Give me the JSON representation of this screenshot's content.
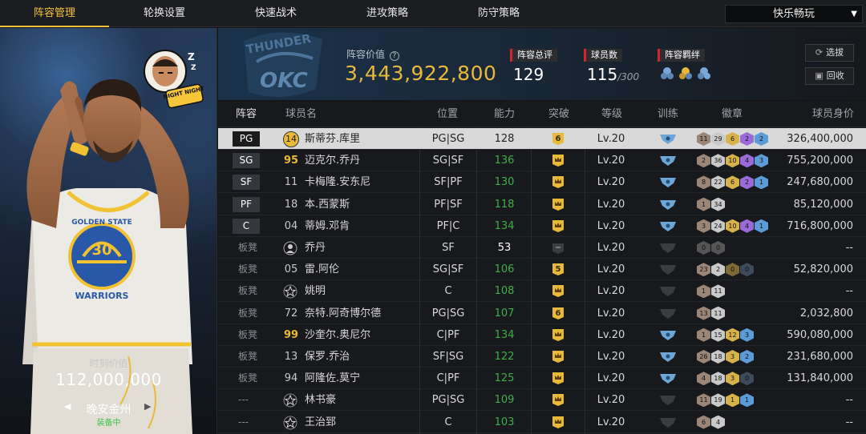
{
  "tabs": [
    {
      "label": "阵容管理",
      "active": true
    },
    {
      "label": "轮换设置",
      "active": false
    },
    {
      "label": "快速战术",
      "active": false
    },
    {
      "label": "进攻策略",
      "active": false
    },
    {
      "label": "防守策略",
      "active": false
    }
  ],
  "mode_dropdown": {
    "value": "快乐畅玩"
  },
  "player_card": {
    "emote_text": "NIGHT NIGHT",
    "moment_label": "时刻价值",
    "moment_value": "112,000,000",
    "card_name": "晚安金州",
    "status": "装备中"
  },
  "header": {
    "team_logo_text": "OKC",
    "lineup_value_label": "阵容价值",
    "lineup_value": "3,443,922,800",
    "overall_label": "阵容总评",
    "overall_value": "129",
    "player_count_label": "球员数",
    "player_count": "115",
    "player_capacity": "/300",
    "bonds_label": "阵容羁绊",
    "select_button": "选拔",
    "recycle_button": "回收"
  },
  "table": {
    "columns": [
      "阵容",
      "球员名",
      "位置",
      "能力",
      "突破",
      "等级",
      "训练",
      "徽章",
      "球员身价"
    ],
    "rows": [
      {
        "slot": "PG",
        "jersey": "14",
        "jersey_style": "circle",
        "name": "斯蒂芬.库里",
        "position": "PG|SG",
        "ability": "128",
        "breakthrough": "6",
        "level": "Lv.20",
        "training": "active",
        "badges": [
          {
            "n": "11",
            "c": "#9b8576"
          },
          {
            "n": "29",
            "c": "#c9c9c9"
          },
          {
            "n": "6",
            "c": "#d6b24a"
          },
          {
            "n": "2",
            "c": "#9a6bd8"
          },
          {
            "n": "2",
            "c": "#5b9bd8"
          }
        ],
        "value": "326,400,000",
        "selected": true
      },
      {
        "slot": "SG",
        "jersey": "95",
        "jersey_style": "gold",
        "name": "迈克尔.乔丹",
        "position": "SG|SF",
        "ability": "136",
        "breakthrough": "crown",
        "level": "Lv.20",
        "training": "active",
        "badges": [
          {
            "n": "2",
            "c": "#9b8576"
          },
          {
            "n": "36",
            "c": "#c9c9c9"
          },
          {
            "n": "10",
            "c": "#d6b24a"
          },
          {
            "n": "4",
            "c": "#9a6bd8"
          },
          {
            "n": "3",
            "c": "#5b9bd8"
          }
        ],
        "value": "755,200,000"
      },
      {
        "slot": "SF",
        "jersey": "11",
        "jersey_style": "plain",
        "name": "卡梅隆.安东尼",
        "position": "SF|PF",
        "ability": "130",
        "breakthrough": "crown",
        "level": "Lv.20",
        "training": "active",
        "badges": [
          {
            "n": "8",
            "c": "#9b8576"
          },
          {
            "n": "22",
            "c": "#c9c9c9"
          },
          {
            "n": "6",
            "c": "#d6b24a"
          },
          {
            "n": "2",
            "c": "#9a6bd8"
          },
          {
            "n": "1",
            "c": "#5b9bd8"
          }
        ],
        "value": "247,680,000"
      },
      {
        "slot": "PF",
        "jersey": "18",
        "jersey_style": "plain",
        "name": "本.西蒙斯",
        "position": "PF|SF",
        "ability": "118",
        "breakthrough": "crown",
        "level": "Lv.20",
        "training": "active",
        "badges": [
          {
            "n": "1",
            "c": "#9b8576"
          },
          {
            "n": "34",
            "c": "#c9c9c9"
          }
        ],
        "value": "85,120,000"
      },
      {
        "slot": "C",
        "jersey": "04",
        "jersey_style": "plain",
        "name": "蒂姆.邓肯",
        "position": "PF|C",
        "ability": "134",
        "breakthrough": "crown",
        "level": "Lv.20",
        "training": "active",
        "badges": [
          {
            "n": "3",
            "c": "#9b8576"
          },
          {
            "n": "24",
            "c": "#c9c9c9"
          },
          {
            "n": "10",
            "c": "#d6b24a"
          },
          {
            "n": "4",
            "c": "#9a6bd8"
          },
          {
            "n": "1",
            "c": "#5b9bd8"
          }
        ],
        "value": "716,800,000"
      },
      {
        "slot": "板凳",
        "jersey": "",
        "jersey_style": "anon",
        "name": "乔丹",
        "position": "SF",
        "ability": "53",
        "breakthrough": "none",
        "level": "Lv.20",
        "training": "inactive",
        "badges": [
          {
            "n": "0",
            "c": "#555"
          },
          {
            "n": "0",
            "c": "#555"
          }
        ],
        "value": "--"
      },
      {
        "slot": "板凳",
        "jersey": "05",
        "jersey_style": "plain",
        "name": "雷.阿伦",
        "position": "SG|SF",
        "ability": "106",
        "breakthrough": "5",
        "level": "Lv.20",
        "training": "inactive",
        "badges": [
          {
            "n": "23",
            "c": "#9b8576"
          },
          {
            "n": "2",
            "c": "#c9c9c9"
          },
          {
            "n": "0",
            "c": "#7d6a36"
          },
          {
            "n": "0",
            "c": "#3d4a5a"
          }
        ],
        "value": "52,820,000"
      },
      {
        "slot": "板凳",
        "jersey": "",
        "jersey_style": "star",
        "name": "姚明",
        "position": "C",
        "ability": "108",
        "breakthrough": "crown",
        "level": "Lv.20",
        "training": "inactive",
        "badges": [
          {
            "n": "1",
            "c": "#9b8576"
          },
          {
            "n": "11",
            "c": "#c9c9c9"
          }
        ],
        "value": "--"
      },
      {
        "slot": "板凳",
        "jersey": "72",
        "jersey_style": "plain",
        "name": "奈特.阿奇博尔德",
        "position": "PG|SG",
        "ability": "107",
        "breakthrough": "6",
        "level": "Lv.20",
        "training": "inactive",
        "badges": [
          {
            "n": "13",
            "c": "#9b8576"
          },
          {
            "n": "11",
            "c": "#c9c9c9"
          }
        ],
        "value": "2,032,800"
      },
      {
        "slot": "板凳",
        "jersey": "99",
        "jersey_style": "gold",
        "name": "沙奎尔.奥尼尔",
        "position": "C|PF",
        "ability": "134",
        "breakthrough": "crown",
        "level": "Lv.20",
        "training": "active",
        "badges": [
          {
            "n": "1",
            "c": "#9b8576"
          },
          {
            "n": "15",
            "c": "#c9c9c9"
          },
          {
            "n": "12",
            "c": "#d6b24a"
          },
          {
            "n": "3",
            "c": "#5b9bd8"
          }
        ],
        "value": "590,080,000"
      },
      {
        "slot": "板凳",
        "jersey": "13",
        "jersey_style": "plain",
        "name": "保罗.乔治",
        "position": "SF|SG",
        "ability": "122",
        "breakthrough": "crown",
        "level": "Lv.20",
        "training": "active",
        "badges": [
          {
            "n": "26",
            "c": "#9b8576"
          },
          {
            "n": "18",
            "c": "#c9c9c9"
          },
          {
            "n": "3",
            "c": "#d6b24a"
          },
          {
            "n": "2",
            "c": "#5b9bd8"
          }
        ],
        "value": "231,680,000"
      },
      {
        "slot": "板凳",
        "jersey": "94",
        "jersey_style": "plain",
        "name": "阿隆佐.莫宁",
        "position": "C|PF",
        "ability": "125",
        "breakthrough": "crown",
        "level": "Lv.20",
        "training": "active",
        "badges": [
          {
            "n": "4",
            "c": "#9b8576"
          },
          {
            "n": "18",
            "c": "#c9c9c9"
          },
          {
            "n": "3",
            "c": "#d6b24a"
          },
          {
            "n": "0",
            "c": "#3d4a5a"
          }
        ],
        "value": "131,840,000"
      },
      {
        "slot": "---",
        "jersey": "",
        "jersey_style": "star",
        "name": "林书豪",
        "position": "PG|SG",
        "ability": "109",
        "breakthrough": "crown",
        "level": "Lv.20",
        "training": "inactive",
        "badges": [
          {
            "n": "11",
            "c": "#9b8576"
          },
          {
            "n": "19",
            "c": "#c9c9c9"
          },
          {
            "n": "1",
            "c": "#d6b24a"
          },
          {
            "n": "1",
            "c": "#5b9bd8"
          }
        ],
        "value": "--"
      },
      {
        "slot": "---",
        "jersey": "",
        "jersey_style": "star",
        "name": "王治郅",
        "position": "C",
        "ability": "103",
        "breakthrough": "crown",
        "level": "Lv.20",
        "training": "inactive",
        "badges": [
          {
            "n": "6",
            "c": "#9b8576"
          },
          {
            "n": "4",
            "c": "#c9c9c9"
          }
        ],
        "value": "--"
      }
    ]
  },
  "colors": {
    "accent": "#f4c23a",
    "value_gold": "#e9b93a",
    "ability_green": "#3fae48",
    "tag_red": "#d0262d"
  }
}
